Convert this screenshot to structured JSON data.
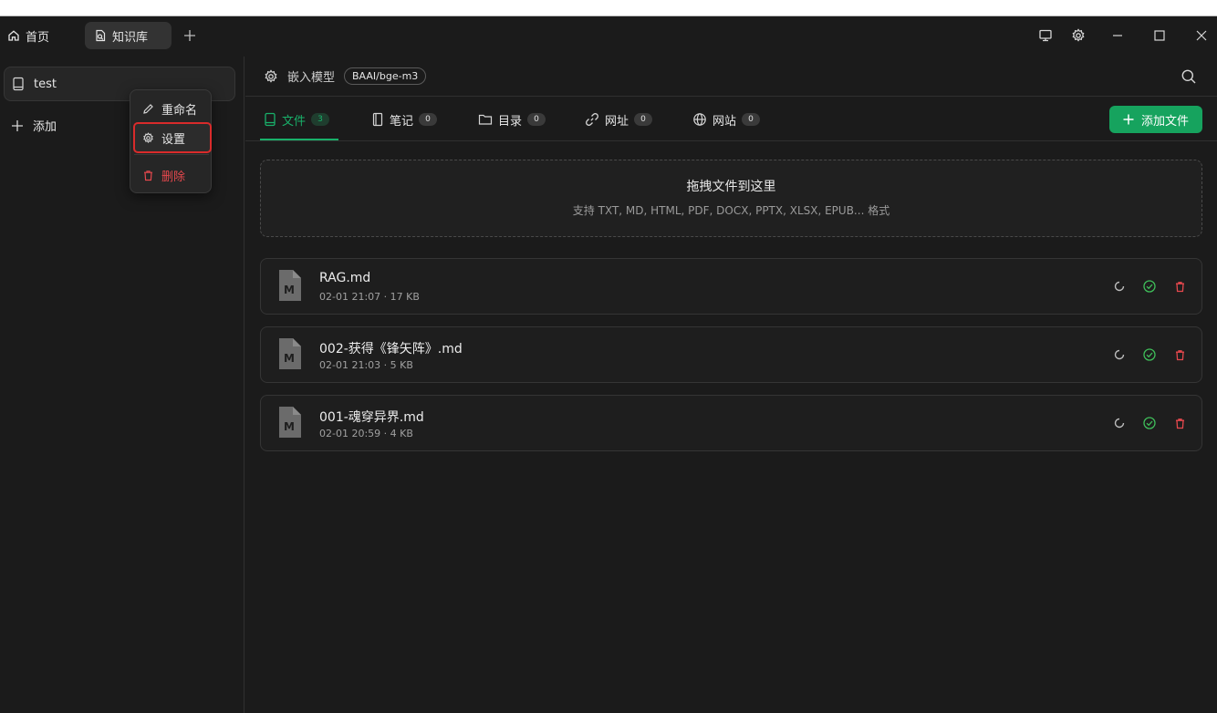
{
  "titlebar": {
    "tabs": [
      {
        "label": "首页",
        "icon": "home-icon"
      },
      {
        "label": "知识库",
        "icon": "knowledge-icon"
      }
    ]
  },
  "sidebar": {
    "kb_name": "test",
    "add_label": "添加"
  },
  "context_menu": {
    "rename": "重命名",
    "settings": "设置",
    "delete": "删除"
  },
  "model_bar": {
    "label": "嵌入模型",
    "model": "BAAI/bge-m3"
  },
  "tabs": [
    {
      "label": "文件",
      "count": "3"
    },
    {
      "label": "笔记",
      "count": "0"
    },
    {
      "label": "目录",
      "count": "0"
    },
    {
      "label": "网址",
      "count": "0"
    },
    {
      "label": "网站",
      "count": "0"
    }
  ],
  "add_file_label": "添加文件",
  "dropzone": {
    "title": "拖拽文件到这里",
    "subtitle": "支持 TXT, MD, HTML, PDF, DOCX, PPTX, XLSX, EPUB... 格式"
  },
  "files": [
    {
      "name": "RAG.md",
      "meta": "02-01 21:07 · 17 KB",
      "type_letter": "M"
    },
    {
      "name": "002-获得《锋矢阵》.md",
      "meta": "02-01 21:03 · 5 KB",
      "type_letter": "M"
    },
    {
      "name": "001-魂穿异界.md",
      "meta": "02-01 20:59 · 4 KB",
      "type_letter": "M"
    }
  ],
  "colors": {
    "accent": "#16a35e",
    "danger": "#e5484d",
    "background": "#1b1b1b"
  }
}
